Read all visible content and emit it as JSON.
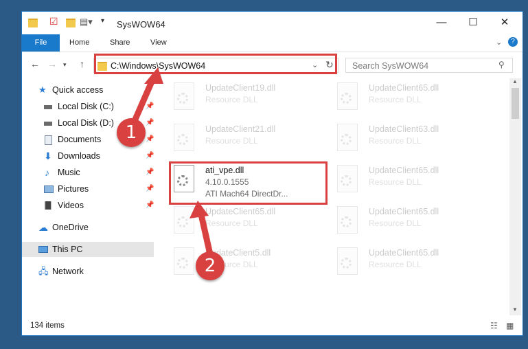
{
  "window": {
    "title": "SysWOW64"
  },
  "ribbon": {
    "file": "File",
    "tabs": [
      "Home",
      "Share",
      "View"
    ]
  },
  "address": {
    "path": "C:\\Windows\\SysWOW64"
  },
  "search": {
    "placeholder": "Search SysWOW64"
  },
  "sidebar": {
    "quick_access": "Quick access",
    "items": [
      {
        "label": "Local Disk (C:)"
      },
      {
        "label": "Local Disk (D:)"
      },
      {
        "label": "Documents"
      },
      {
        "label": "Downloads"
      },
      {
        "label": "Music"
      },
      {
        "label": "Pictures"
      },
      {
        "label": "Videos"
      }
    ],
    "onedrive": "OneDrive",
    "thispc": "This PC",
    "network": "Network"
  },
  "files": {
    "left": [
      {
        "name": "UpdateClient19.dll",
        "type": "Resource DLL"
      },
      {
        "name": "UpdateClient21.dll",
        "type": "Resource DLL"
      },
      {
        "name": "UpdateClient65.dll",
        "type": "Resource DLL"
      },
      {
        "name": "UpdateClient5.dll",
        "type": "Resource DLL"
      }
    ],
    "right": [
      {
        "name": "UpdateClient65.dll",
        "type": "Resource DLL"
      },
      {
        "name": "UpdateClient63.dll",
        "type": "Resource DLL"
      },
      {
        "name": "UpdateClient65.dll",
        "type": "Resource DLL"
      },
      {
        "name": "UpdateClient65.dll",
        "type": "Resource DLL"
      },
      {
        "name": "UpdateClient65.dll",
        "type": "Resource DLL"
      }
    ],
    "highlighted": {
      "name": "ati_vpe.dll",
      "version": "4.10.0.1555",
      "desc": "ATI Mach64 DirectDr..."
    }
  },
  "status": {
    "count": "134 items"
  },
  "annotations": {
    "step1": "1",
    "step2": "2",
    "color": "#d94141"
  }
}
